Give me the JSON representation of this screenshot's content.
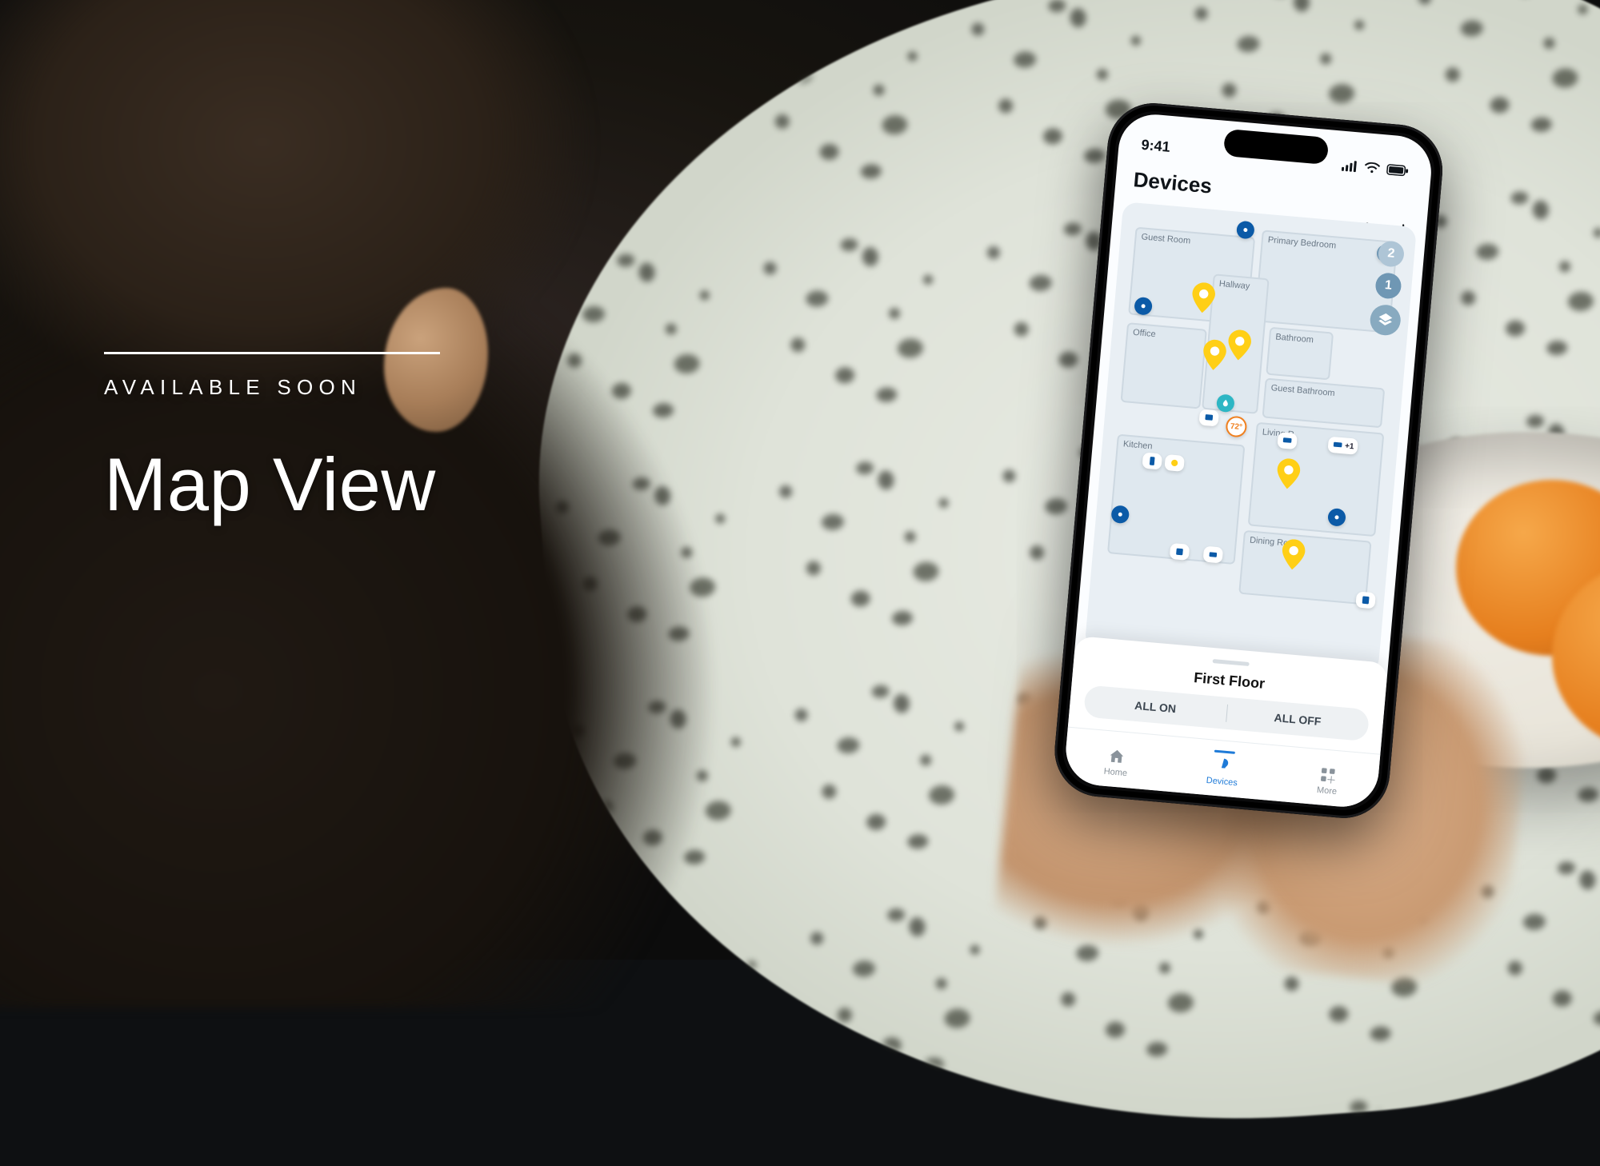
{
  "overlay": {
    "eyebrow": "AVAILABLE SOON",
    "title": "Map View"
  },
  "statusbar": {
    "time": "9:41"
  },
  "app": {
    "title": "Devices"
  },
  "floor_selector": {
    "labels": [
      "2",
      "1"
    ]
  },
  "rooms": {
    "guest_room": "Guest Room",
    "primary_bedroom": "Primary Bedroom",
    "hallway": "Hallway",
    "office": "Office",
    "bathroom": "Bathroom",
    "guest_bathroom": "Guest Bathroom",
    "living_room": "Living R",
    "kitchen": "Kitchen",
    "dining_room": "Dining Room"
  },
  "temp_badge": "72°",
  "device_group_badge": "+1",
  "sheet": {
    "floor_name": "First Floor",
    "all_on": "ALL ON",
    "all_off": "ALL OFF"
  },
  "tabs": {
    "home": "Home",
    "devices": "Devices",
    "more": "More"
  },
  "colors": {
    "pin_yellow": "#ffcf16",
    "pin_blue": "#0b5aa7",
    "accent_blue": "#1f7bd8",
    "temp_orange": "#f0801f",
    "dot_teal": "#2db6c4"
  }
}
